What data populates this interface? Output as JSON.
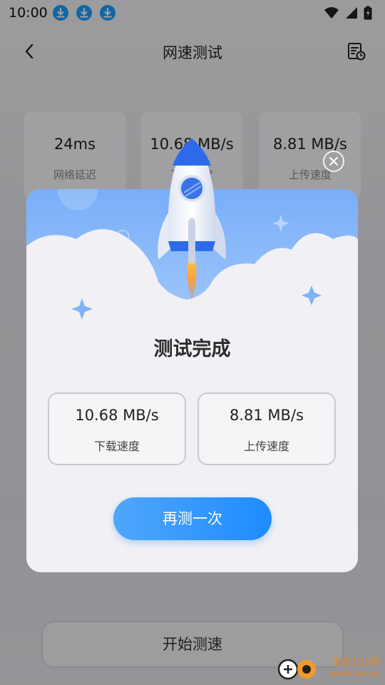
{
  "status_bar": {
    "time": "10:00",
    "download_icons": [
      "download-icon",
      "download-icon",
      "download-icon"
    ],
    "right_icons": [
      "wifi-icon",
      "cell-signal-icon",
      "battery-icon"
    ]
  },
  "header": {
    "title": "网速测试",
    "back_icon": "chevron-left-icon",
    "history_icon": "history-icon"
  },
  "stats": [
    {
      "value": "24ms",
      "label": "网络延迟"
    },
    {
      "value": "10.68 MB/s",
      "label": "下载速度"
    },
    {
      "value": "8.81 MB/s",
      "label": "上传速度"
    }
  ],
  "start_button": {
    "label": "开始测速"
  },
  "modal": {
    "title": "测试完成",
    "results": [
      {
        "value": "10.68 MB/s",
        "label": "下载速度"
      },
      {
        "value": "8.81 MB/s",
        "label": "上传速度"
      }
    ],
    "retest_label": "再测一次",
    "close_icon": "close-icon",
    "illustration": "rocket-icon"
  },
  "watermark": {
    "text": "手机100网",
    "sub": "mobile100.com"
  },
  "colors": {
    "accent": "#1e8bff",
    "sky": "#78aef8",
    "status_icon": "#1ba1ff"
  }
}
